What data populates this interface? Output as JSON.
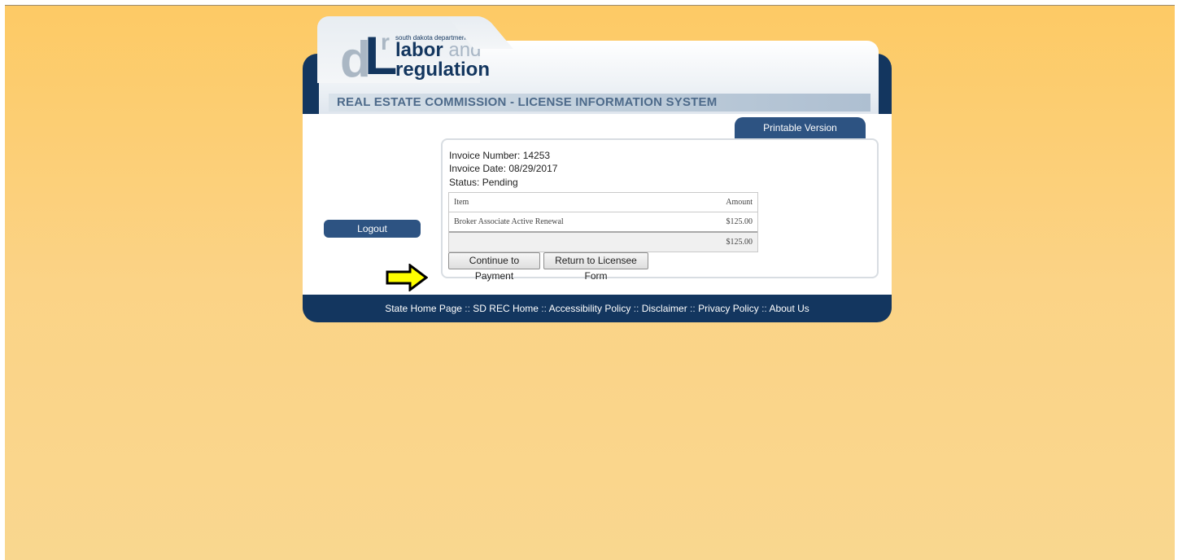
{
  "header": {
    "logo_small_text": "south dakota department of",
    "logo_labor": "labor",
    "logo_and": "and",
    "logo_regulation": "regulation",
    "logo_mark_d": "d",
    "logo_mark_l": "L",
    "logo_mark_r": "r",
    "title": "REAL ESTATE COMMISSION - LICENSE INFORMATION SYSTEM"
  },
  "printable_tab": "Printable Version",
  "sidebar": {
    "logout_label": "Logout"
  },
  "invoice": {
    "number_line": "Invoice Number: 14253",
    "date_line": "Invoice Date: 08/29/2017",
    "status_line": "Status: Pending",
    "columns": [
      "Item",
      "Amount"
    ],
    "rows": [
      {
        "item": "Broker Associate Active Renewal",
        "amount": "$125.00"
      }
    ],
    "total": "$125.00"
  },
  "actions": {
    "continue_label": "Continue to Payment",
    "return_label": "Return to Licensee Form"
  },
  "annotation": {
    "arrow_icon": "yellow-right-arrow"
  },
  "footer": {
    "links": [
      "State Home Page",
      "SD REC Home",
      "Accessibility Policy",
      "Disclaimer",
      "Privacy Policy",
      "About Us"
    ],
    "separator": " :: "
  },
  "colors": {
    "navy": "#13365f",
    "tab_blue": "#2d5382",
    "background_orange": "#fdca65",
    "arrow_yellow": "#ffff00"
  }
}
